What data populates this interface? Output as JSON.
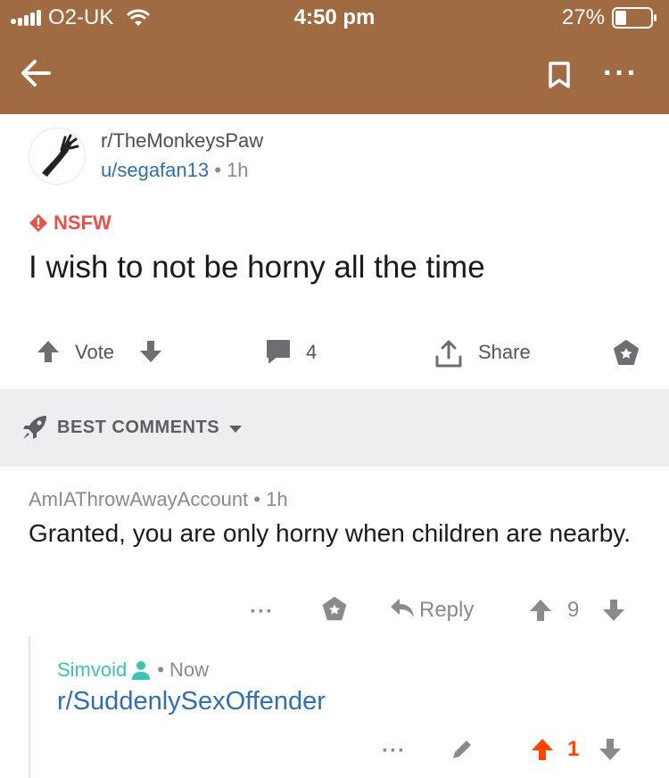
{
  "status": {
    "carrier": "O2-UK",
    "time": "4:50 pm",
    "battery": "27%"
  },
  "post": {
    "subreddit": "r/TheMonkeysPaw",
    "author": "u/segafan13",
    "separator": "•",
    "age": "1h",
    "nsfw_label": "NSFW",
    "title": "I wish to not be horny all the time",
    "vote_label": "Vote",
    "comment_count": "4",
    "share_label": "Share"
  },
  "sort": {
    "label": "BEST COMMENTS"
  },
  "comment": {
    "author": "AmIAThrowAwayAccount",
    "separator": "•",
    "age": "1h",
    "body": "Granted, you are only horny when children are nearby.",
    "more": "···",
    "reply_label": "Reply",
    "score": "9"
  },
  "reply": {
    "author": "Simvoid",
    "separator": "•",
    "age": "Now",
    "body": "r/SuddenlySexOffender",
    "more": "···",
    "score": "1"
  },
  "colors": {
    "header": "#a06a42",
    "link": "#2f6fb4",
    "nsfw": "#e8504a",
    "op_author": "#3fc3ad",
    "upvoted": "#ff4500"
  },
  "icons": [
    "signal-icon",
    "wifi-icon",
    "battery-icon",
    "back-arrow-icon",
    "bookmark-icon",
    "more-icon",
    "nsfw-icon",
    "upvote-icon",
    "downvote-icon",
    "comment-icon",
    "share-icon",
    "award-icon",
    "rocket-icon",
    "caret-down-icon",
    "reply-icon",
    "user-icon",
    "edit-icon"
  ]
}
